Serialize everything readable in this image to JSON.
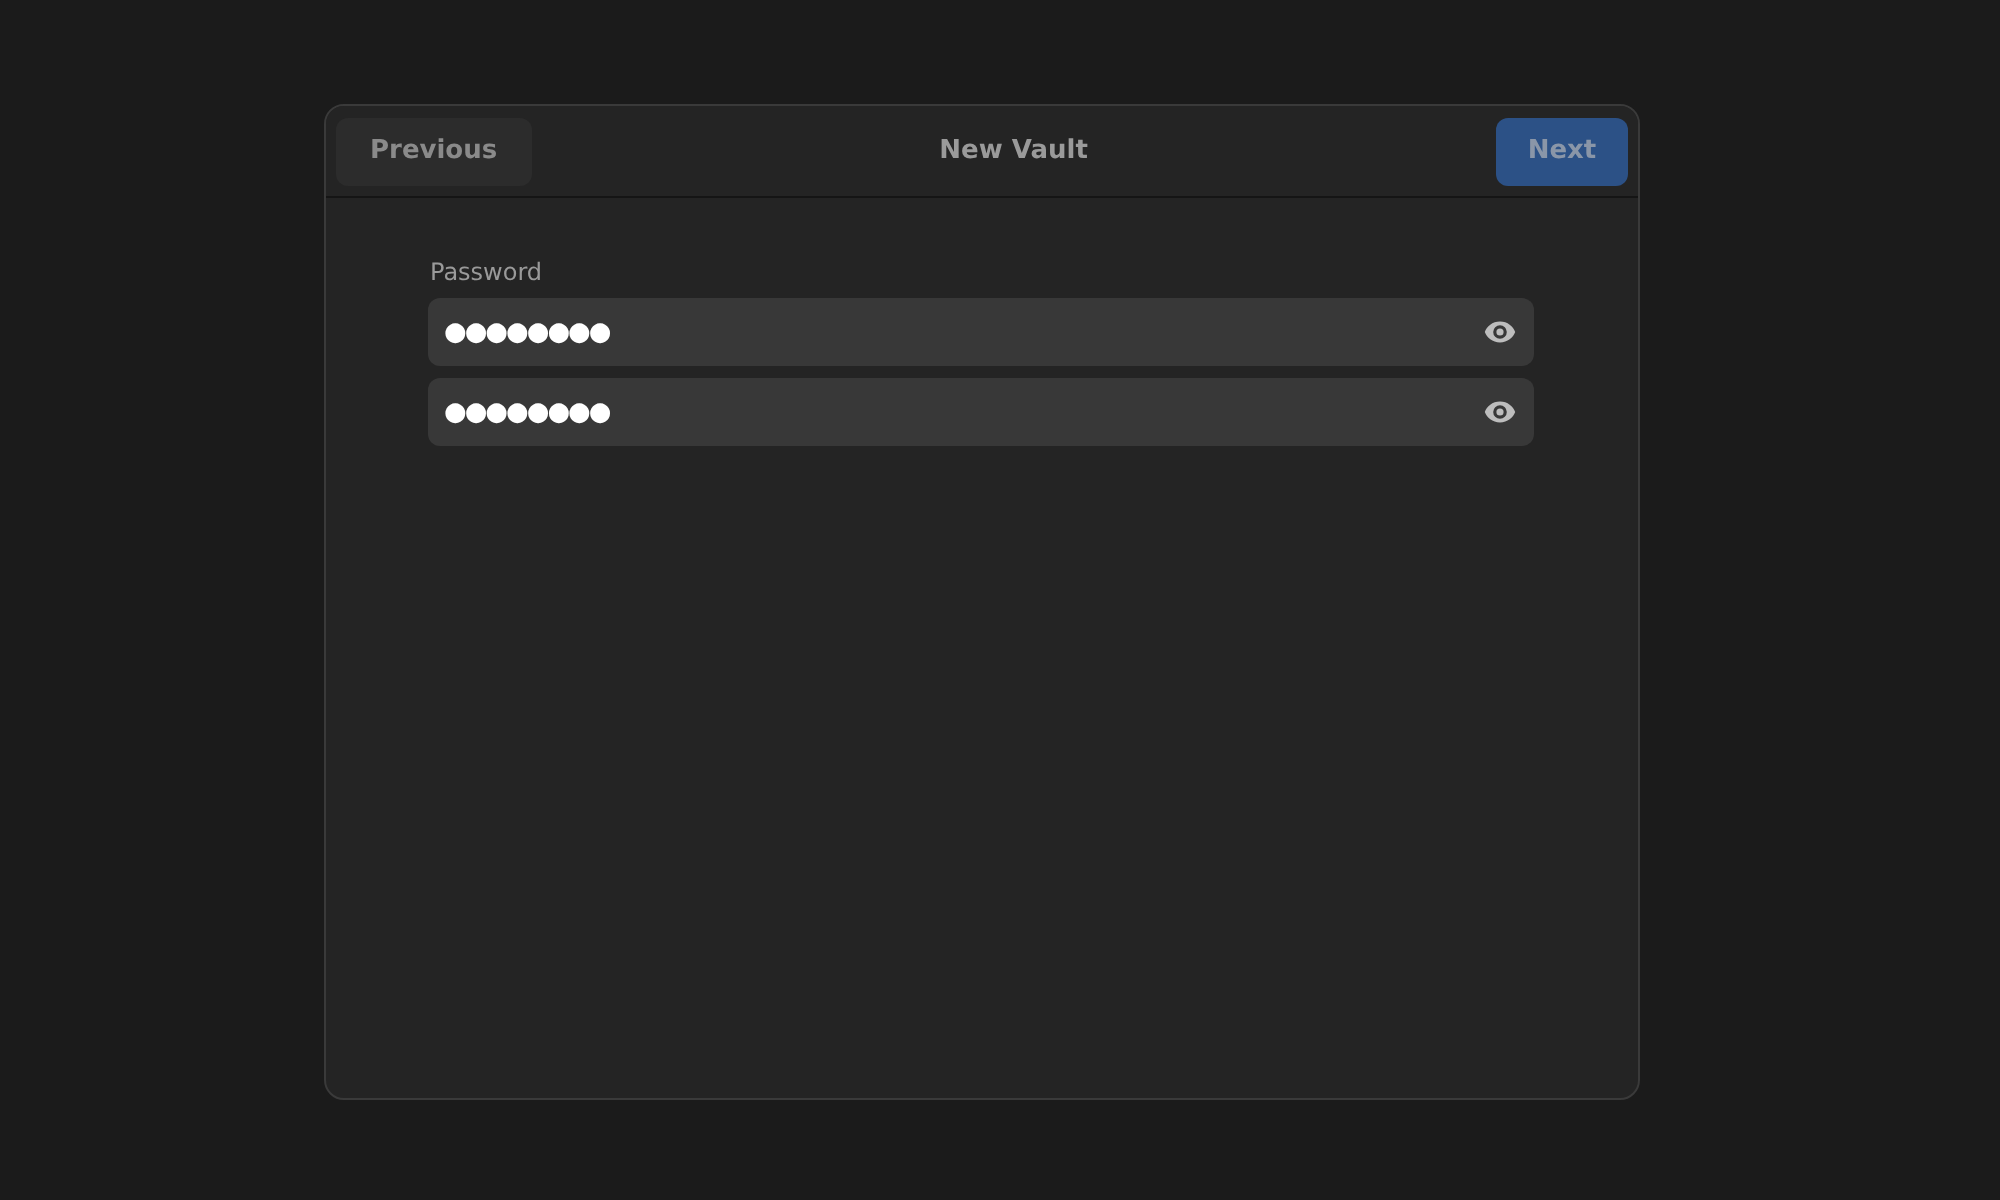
{
  "window": {
    "title": "New Vault"
  },
  "header_buttons": [
    {
      "label": "Previous",
      "kind": "plain",
      "disabled": true
    },
    {
      "label": "Next",
      "kind": "suggested",
      "disabled": true
    }
  ],
  "password": {
    "label": "Password",
    "fields": [
      {
        "value": "●●●●●●●●"
      },
      {
        "value": "●●●●●●●●"
      }
    ]
  }
}
